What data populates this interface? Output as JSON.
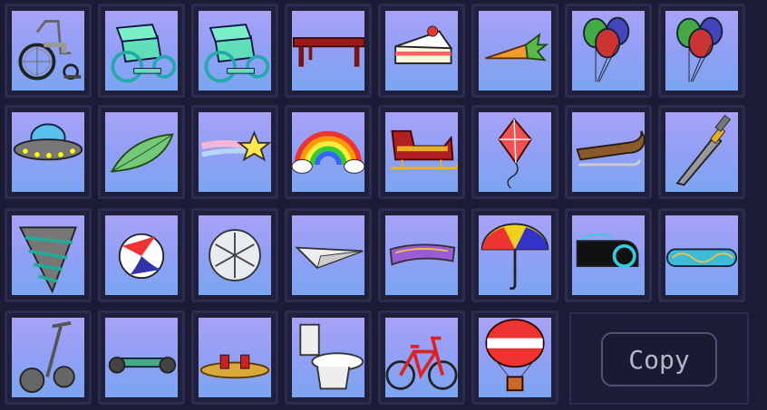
{
  "items": [
    {
      "name": "wheelchair"
    },
    {
      "name": "green-wheelchair"
    },
    {
      "name": "green-wheelchair"
    },
    {
      "name": "bench"
    },
    {
      "name": "cake-slice"
    },
    {
      "name": "carrot"
    },
    {
      "name": "balloons"
    },
    {
      "name": "balloons"
    },
    {
      "name": "ufo"
    },
    {
      "name": "leaf"
    },
    {
      "name": "shooting-star"
    },
    {
      "name": "rainbow"
    },
    {
      "name": "sleigh"
    },
    {
      "name": "kite"
    },
    {
      "name": "toboggan"
    },
    {
      "name": "sword"
    },
    {
      "name": "drill"
    },
    {
      "name": "beach-ball"
    },
    {
      "name": "snowflake-shield"
    },
    {
      "name": "paper-plane"
    },
    {
      "name": "magic-carpet"
    },
    {
      "name": "umbrella"
    },
    {
      "name": "light-cycle"
    },
    {
      "name": "hoverboard"
    },
    {
      "name": "segway"
    },
    {
      "name": "hoverboard-scooter"
    },
    {
      "name": "rocket-boots"
    },
    {
      "name": "toilet"
    },
    {
      "name": "bicycle"
    },
    {
      "name": "hot-air-balloon"
    }
  ],
  "copy_button": {
    "label": "Copy"
  },
  "colors": {
    "tile_top": "#a7a2f6",
    "tile_bottom": "#7ba5f2",
    "background": "#1b1b36"
  }
}
